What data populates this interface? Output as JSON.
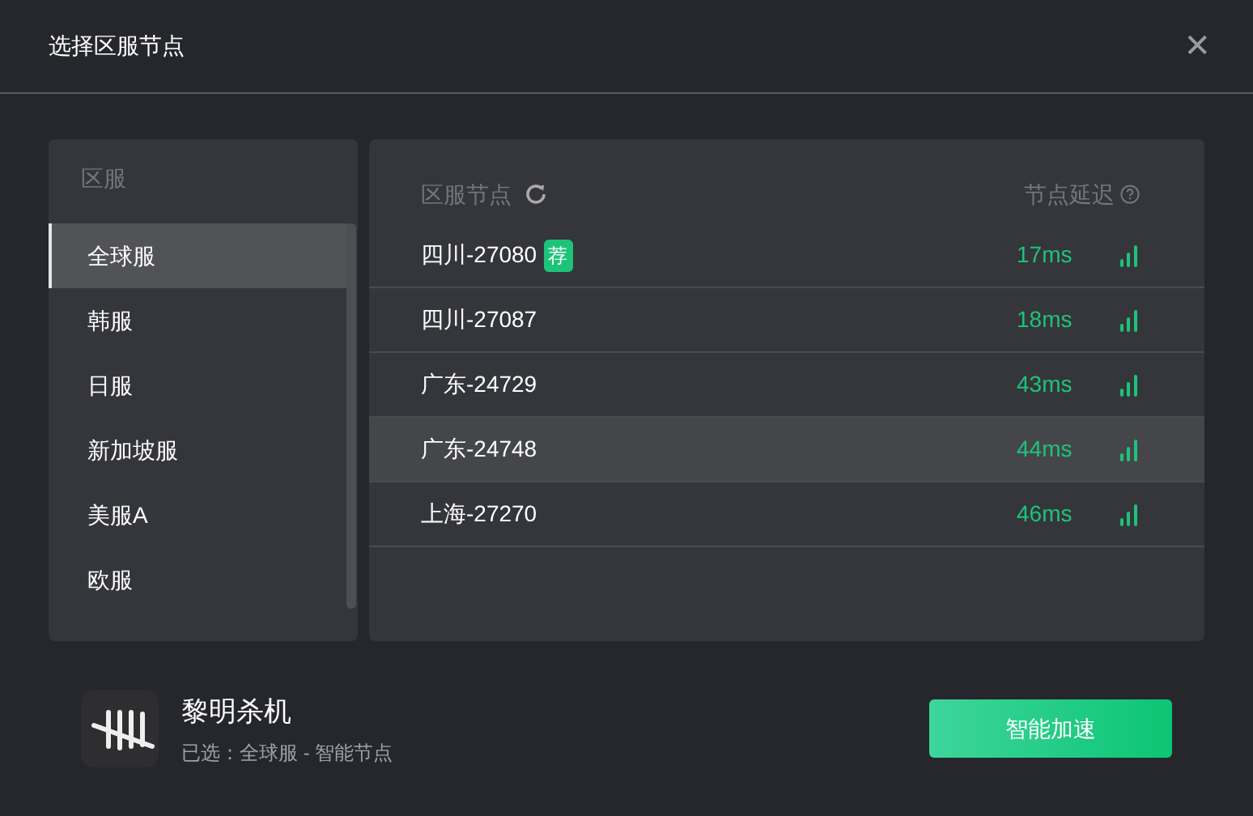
{
  "window": {
    "title": "选择区服节点",
    "close": "✕"
  },
  "regions": {
    "heading": "区服",
    "items": [
      {
        "label": "全球服",
        "selected": true
      },
      {
        "label": "韩服",
        "selected": false
      },
      {
        "label": "日服",
        "selected": false
      },
      {
        "label": "新加坡服",
        "selected": false
      },
      {
        "label": "美服A",
        "selected": false
      },
      {
        "label": "欧服",
        "selected": false
      }
    ]
  },
  "nodes": {
    "heading": "区服节点",
    "latency_heading": "节点延迟",
    "rows": [
      {
        "name": "四川-27080",
        "badge": "荐",
        "latency": "17ms",
        "highlighted": false
      },
      {
        "name": "四川-27087",
        "latency": "18ms",
        "highlighted": false
      },
      {
        "name": "广东-24729",
        "latency": "43ms",
        "highlighted": false
      },
      {
        "name": "广东-24748",
        "latency": "44ms",
        "highlighted": true
      },
      {
        "name": "上海-27270",
        "latency": "46ms",
        "highlighted": false
      }
    ]
  },
  "game": {
    "title": "黎明杀机",
    "selection": "已选：全球服 - 智能节点"
  },
  "buttons": [
    {
      "label": "智能加速"
    }
  ]
}
